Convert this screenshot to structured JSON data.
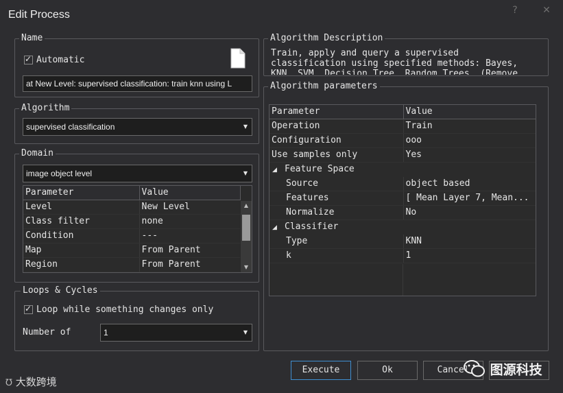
{
  "window": {
    "title": "Edit Process",
    "help_glyph": "?",
    "close_glyph": "✕"
  },
  "name_group": {
    "legend": "Name",
    "automatic_label": "Automatic",
    "automatic_checked": true,
    "name_value": "at  New Level: supervised classification: train knn using L",
    "icon": "document-icon"
  },
  "algorithm_group": {
    "legend": "Algorithm",
    "selected": "supervised classification"
  },
  "domain_group": {
    "legend": "Domain",
    "selected": "image object level",
    "columns": [
      "Parameter",
      "Value"
    ],
    "rows": [
      {
        "param": "Level",
        "value": "New Level"
      },
      {
        "param": "Class filter",
        "value": "none"
      },
      {
        "param": "Condition",
        "value": "---"
      },
      {
        "param": "Map",
        "value": "From Parent"
      },
      {
        "param": "Region",
        "value": "From Parent"
      }
    ]
  },
  "loops_group": {
    "legend": "Loops & Cycles",
    "loop_label": "Loop while something changes only",
    "loop_checked": true,
    "number_label": "Number of",
    "number_value": "1"
  },
  "desc_group": {
    "legend": "Algorithm Description",
    "line1": "Train, apply and query a supervised",
    "line2": "classification using specified methods: Bayes,",
    "line3": "KNN, SVM, Decision Tree, Random Trees. (Remove"
  },
  "params_group": {
    "legend": "Algorithm parameters",
    "columns": [
      "Parameter",
      "Value"
    ],
    "rows": [
      {
        "param": "Operation",
        "value": "Train"
      },
      {
        "param": "Configuration",
        "value": "ooo"
      },
      {
        "param": "Use samples only",
        "value": "Yes"
      }
    ],
    "feature_space": {
      "label": "Feature Space",
      "rows": [
        {
          "param": "Source",
          "value": "object based"
        },
        {
          "param": "Features",
          "value": "[ Mean Layer 7, Mean..."
        },
        {
          "param": "Normalize",
          "value": "No"
        }
      ]
    },
    "classifier": {
      "label": "Classifier",
      "rows": [
        {
          "param": "Type",
          "value": "KNN"
        },
        {
          "param": "k",
          "value": "1"
        }
      ]
    }
  },
  "buttons": {
    "execute": "Execute",
    "ok": "Ok",
    "cancel": "Cancel"
  },
  "watermarks": {
    "left": "大数跨境",
    "right": "图源科技"
  },
  "colors": {
    "background": "#2d2d30",
    "field": "#1e1e1e",
    "accent": "#3f8fd2"
  }
}
